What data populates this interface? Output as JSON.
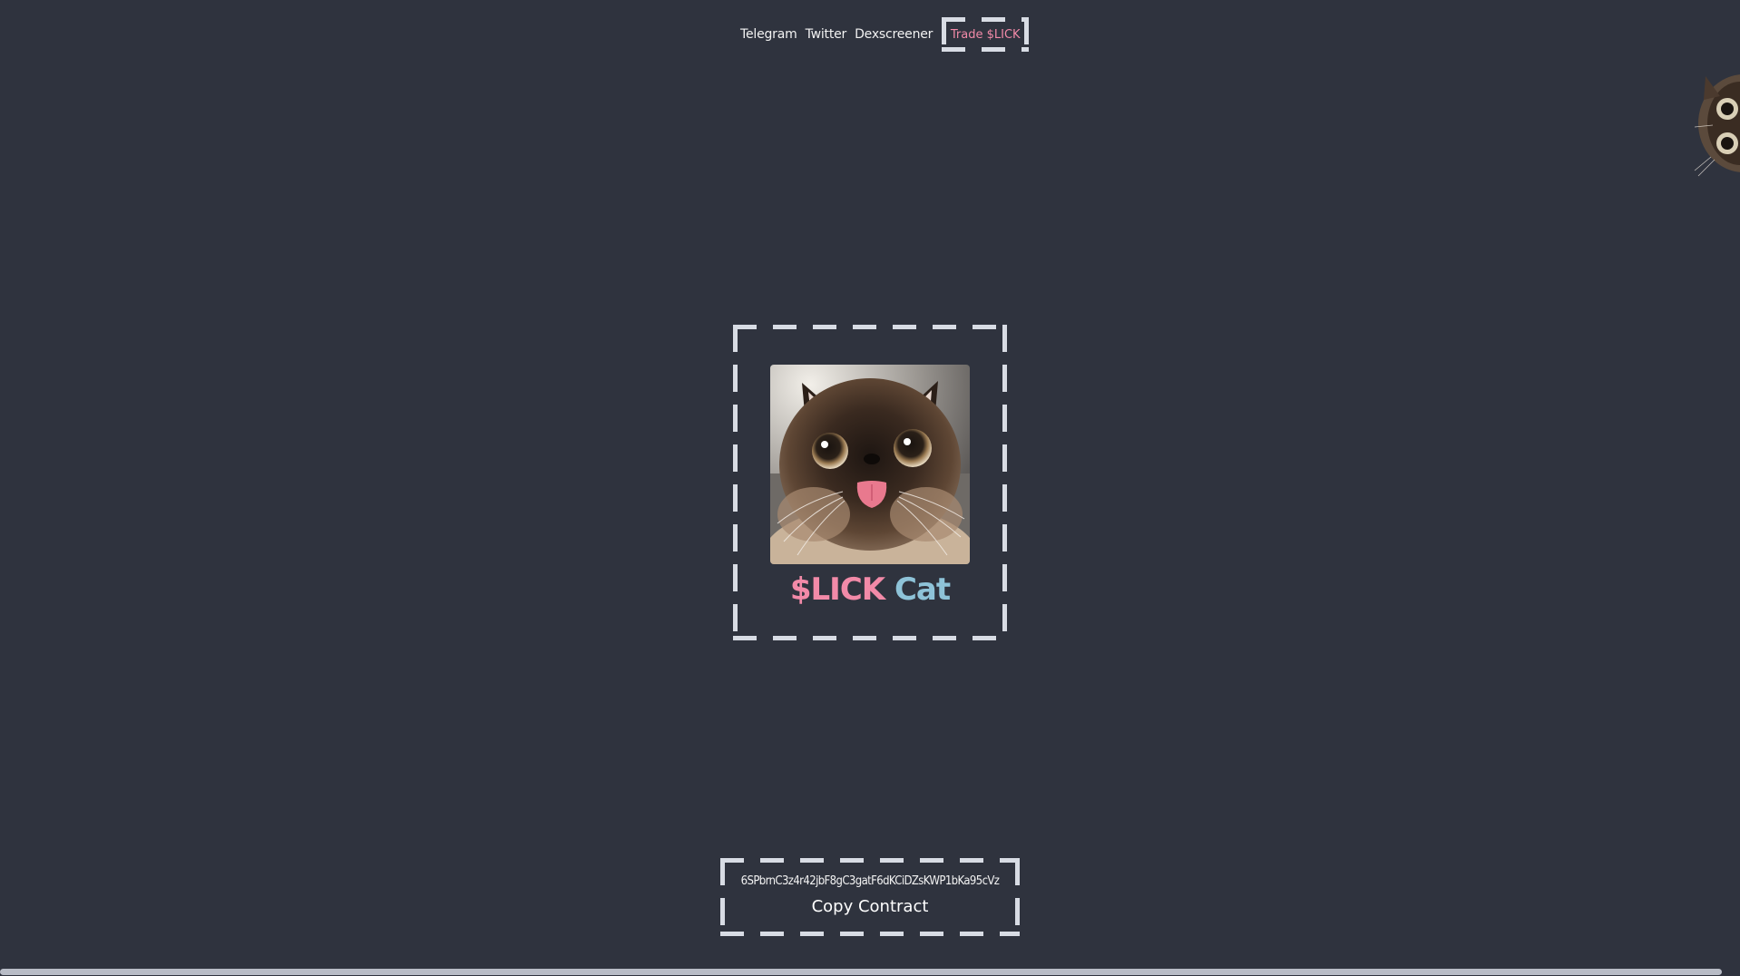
{
  "nav": {
    "links": [
      "Telegram",
      "Twitter",
      "Dexscreener"
    ],
    "trade_label": "Trade $LICK"
  },
  "hero": {
    "title_part1": "$LICK",
    "title_part2": "Cat",
    "image_icon": "cat-with-tongue-out"
  },
  "contract": {
    "address": "6SPbrnC3z4r42jbF8gC3gatF6dKCiDZsKWP1bKa95cVz",
    "copy_label": "Copy Contract"
  },
  "colors": {
    "background": "#2f333e",
    "accent_pink": "#f28aa8",
    "accent_blue": "#8ec3d8",
    "border": "#d8dce4"
  }
}
